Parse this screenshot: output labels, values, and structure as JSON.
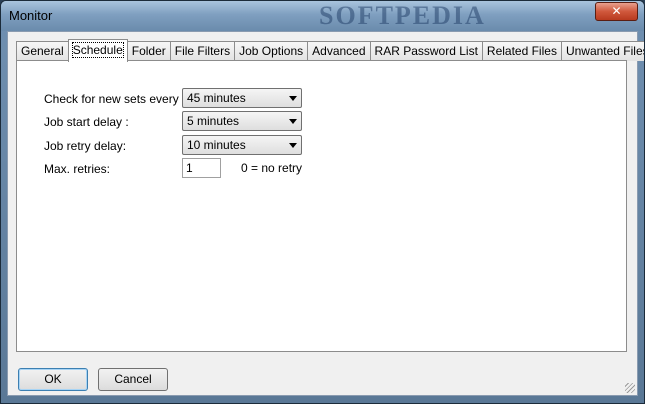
{
  "window": {
    "title": "Monitor",
    "watermark": "SOFTPEDIA",
    "close_glyph": "✕"
  },
  "tabs": [
    {
      "label": "General",
      "active": false
    },
    {
      "label": "Schedule",
      "active": true
    },
    {
      "label": "Folder",
      "active": false
    },
    {
      "label": "File Filters",
      "active": false
    },
    {
      "label": "Job Options",
      "active": false
    },
    {
      "label": "Advanced",
      "active": false
    },
    {
      "label": "RAR Password List",
      "active": false
    },
    {
      "label": "Related Files",
      "active": false
    },
    {
      "label": "Unwanted Files",
      "active": false
    }
  ],
  "schedule": {
    "check_label": "Check for new sets every :",
    "check_value": "45 minutes",
    "start_label": "Job start delay :",
    "start_value": "5 minutes",
    "retry_label": "Job retry delay:",
    "retry_value": "10 minutes",
    "max_label": "Max. retries:",
    "max_value": "1",
    "max_hint": "0 = no retry"
  },
  "buttons": {
    "ok": "OK",
    "cancel": "Cancel"
  }
}
